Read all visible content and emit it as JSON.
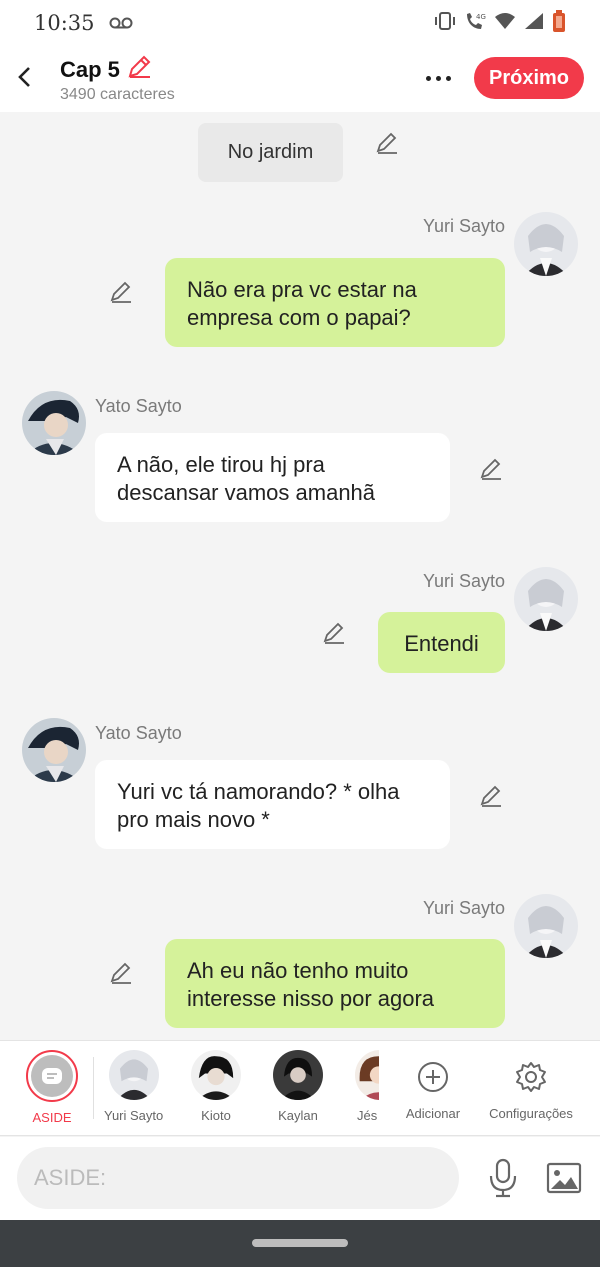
{
  "status": {
    "time": "10:35",
    "icons": [
      "voicemail-icon",
      "vibrate-icon",
      "call-4g-icon",
      "wifi-icon",
      "signal-icon",
      "battery-icon"
    ]
  },
  "header": {
    "title": "Cap 5",
    "char_count": "3490 caracteres",
    "next_label": "Próximo",
    "accent_color": "#f23a4a"
  },
  "chat": {
    "narration": "No jardim",
    "messages": [
      {
        "sender": "Yuri Sayto",
        "side": "right",
        "line1": "Não era pra vc estar na",
        "line2": "empresa com o papai?"
      },
      {
        "sender": "Yato Sayto",
        "side": "left",
        "line1": "A não, ele tirou hj pra",
        "line2": "descansar vamos amanhã"
      },
      {
        "sender": "Yuri Sayto",
        "side": "right",
        "line1": "Entendi",
        "line2": ""
      },
      {
        "sender": "Yato Sayto",
        "side": "left",
        "line1": "Yuri vc tá namorando? * olha",
        "line2": "pro mais novo *"
      },
      {
        "sender": "Yuri Sayto",
        "side": "right",
        "line1": "Ah eu não tenho muito",
        "line2": "interesse nisso por agora"
      }
    ],
    "bubble_color_right": "#d5f29a",
    "bubble_color_left": "#ffffff"
  },
  "characters": [
    {
      "label": "ASIDE",
      "selected": true
    },
    {
      "label": "Yuri Sayto"
    },
    {
      "label": "Kioto"
    },
    {
      "label": "Kaylan"
    },
    {
      "label": "Jés"
    },
    {
      "label": "Adicionar"
    },
    {
      "label": "Configurações"
    }
  ],
  "input": {
    "placeholder": "ASIDE:",
    "value": ""
  }
}
